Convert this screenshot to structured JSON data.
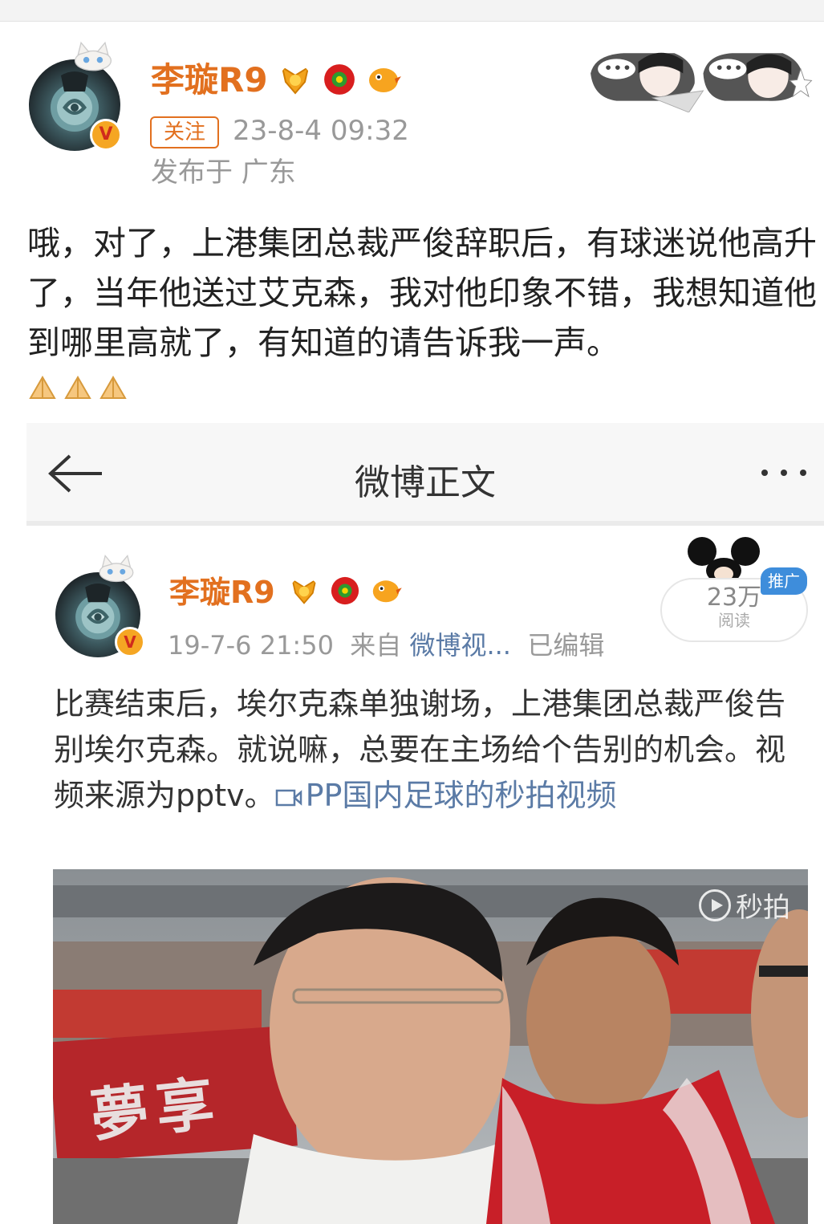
{
  "outer_post": {
    "username": "李璇R9",
    "follow_label": "关注",
    "timestamp": "23-8-4 09:32",
    "location": "发布于 广东",
    "text": "哦，对了，上港集团总裁严俊辞职后，有球迷说他高升了，当年他送过艾克森，我对他印象不错，我想知道他到哪里高就了，有知道的请告诉我一声。",
    "verified_badge": "V",
    "icons": [
      "avatar",
      "verified-badge",
      "medal-icon",
      "red-flower-icon",
      "bird-icon",
      "cartoon-sticker",
      "pray-emoji"
    ],
    "accent_color": "#e2701f"
  },
  "embedded": {
    "topbar_title": "微博正文",
    "post": {
      "username": "李璇R9",
      "timestamp": "19-7-6 21:50",
      "source_prefix": "来自",
      "source": "微博视...",
      "edited": "已编辑",
      "reads_count": "23万",
      "reads_label": "阅读",
      "promo_tag": "推广",
      "text": "比赛结束后，埃尔克森单独谢场，上港集团总裁严俊告别埃尔克森。就说嘛，总要在主场给个告别的机会。视频来源为pptv。",
      "video_link": "PP国内足球的秒拍视频",
      "verified_badge": "V"
    },
    "video": {
      "watermark": "秒拍",
      "banner_text": "夢享"
    },
    "link_color": "#5b7ba6"
  }
}
